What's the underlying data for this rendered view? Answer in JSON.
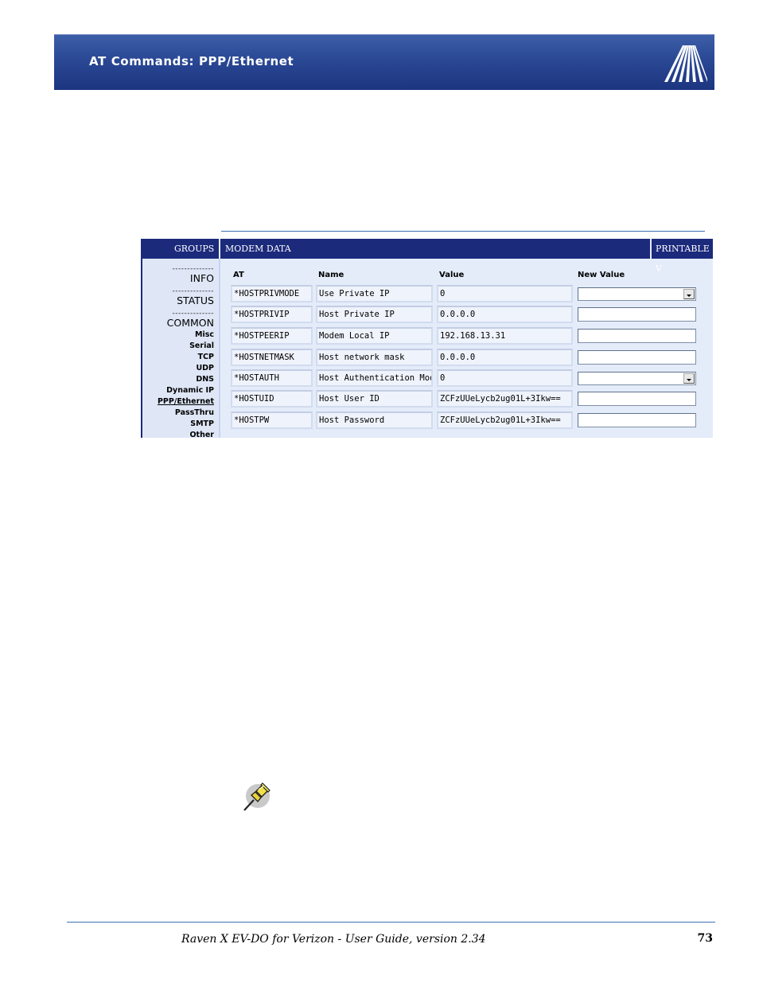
{
  "header": {
    "title": "AT Commands: PPP/Ethernet",
    "logo": "sierra-airlink-logo"
  },
  "app": {
    "tabs": {
      "groups": "GROUPS",
      "modem_data": "MODEM DATA",
      "printable": "PRINTABLE V"
    },
    "sidebar": {
      "dash": "--------------",
      "info": "INFO",
      "status": "STATUS",
      "common": "COMMON",
      "items": [
        "Misc",
        "Serial",
        "TCP",
        "UDP",
        "DNS",
        "Dynamic IP",
        "PPP/Ethernet",
        "PassThru",
        "SMTP",
        "Other"
      ],
      "active_item": "PPP/Ethernet"
    },
    "columns": {
      "at": "AT",
      "name": "Name",
      "value": "Value",
      "new_value": "New Value"
    },
    "rows": [
      {
        "at": "*HOSTPRIVMODE",
        "name": "Use Private IP",
        "value": "0",
        "control": "select"
      },
      {
        "at": "*HOSTPRIVIP",
        "name": "Host Private IP",
        "value": "0.0.0.0",
        "control": "text"
      },
      {
        "at": "*HOSTPEERIP",
        "name": "Modem Local IP",
        "value": "192.168.13.31",
        "control": "text"
      },
      {
        "at": "*HOSTNETMASK",
        "name": "Host network mask",
        "value": "0.0.0.0",
        "control": "text"
      },
      {
        "at": "*HOSTAUTH",
        "name": "Host Authentication Mode",
        "value": "0",
        "control": "select"
      },
      {
        "at": "*HOSTUID",
        "name": "Host User ID",
        "value": "ZCFzUUeLycb2ug01L+3Ikw==",
        "control": "text"
      },
      {
        "at": "*HOSTPW",
        "name": "Host Password",
        "value": "ZCFzUUeLycb2ug01L+3Ikw==",
        "control": "text"
      }
    ]
  },
  "note_icon": "pushpin-icon",
  "footer": {
    "text": "Raven X EV-DO for Verizon - User Guide, version 2.34",
    "page": "73"
  }
}
